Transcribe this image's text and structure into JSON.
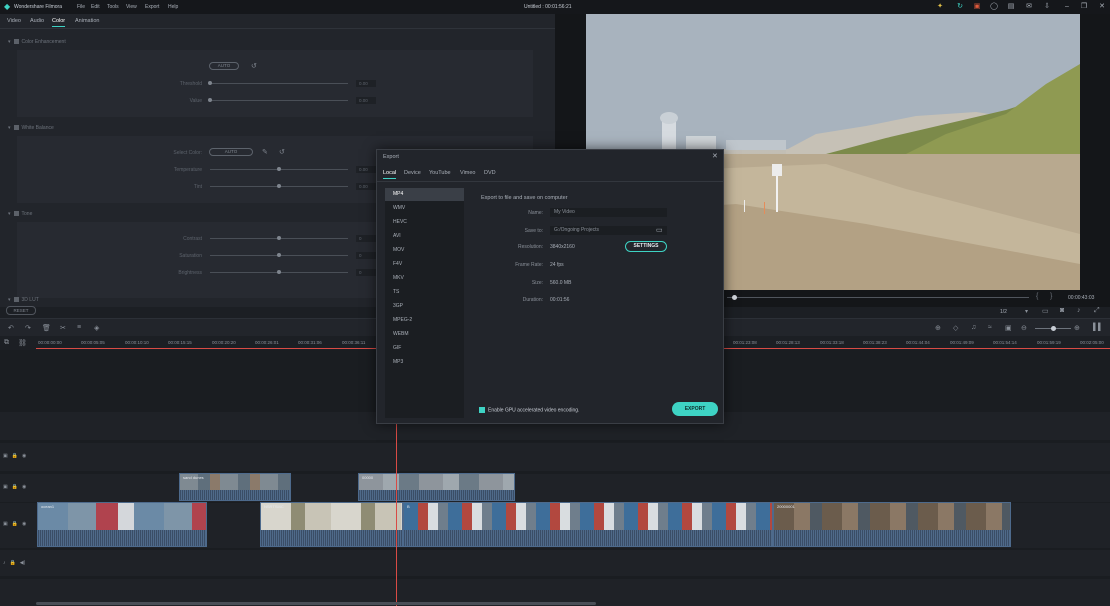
{
  "titlebar": {
    "app_name": "Wondershare Filmora",
    "menu": [
      "File",
      "Edit",
      "Tools",
      "View",
      "Export",
      "Help"
    ],
    "project_title": "Untitled : 00:01:56:21"
  },
  "editor_tabs": [
    "Video",
    "Audio",
    "Color",
    "Animation"
  ],
  "color_panel": {
    "sections": {
      "color_enhancement": "Color Enhancement",
      "white_balance": "White Balance",
      "tone": "Tone",
      "lut": "3D LUT"
    },
    "auto_label": "AUTO",
    "threshold_label": "Threshold",
    "value_label": "Value",
    "threshold_value": "0.00",
    "value_value": "0.00",
    "select_color_label": "Select Color:",
    "temperature_label": "Temperature",
    "tint_label": "Tint",
    "temperature_value": "0.00",
    "tint_value": "0.00",
    "contrast_label": "Contrast",
    "saturation_label": "Saturation",
    "brightness_label": "Brightness",
    "contrast_value": "0",
    "saturation_value": "0",
    "brightness_value": "0",
    "reset_label": "RESET"
  },
  "preview": {
    "timecode": "00:00:43:03",
    "quality": "1/2"
  },
  "timeline": {
    "ruler_ticks": [
      "00:00:00:00",
      "00:00:05:05",
      "00:00:10:10",
      "00:00:15:15",
      "00:00:20:20",
      "00:00:26:01",
      "00:00:31:06",
      "00:00:36:11",
      "00:01:23:08",
      "00:01:28:13",
      "00:01:33:18",
      "00:01:38:23",
      "00:01:44:04",
      "00:01:49:09",
      "00:01:54:14",
      "00:01:59:19",
      "00:02:05:00"
    ],
    "clip_labels": [
      "ocean1",
      "sand dunes",
      "00000",
      "NSRTSI4C",
      "B",
      "20000001"
    ]
  },
  "export_dialog": {
    "title": "Export",
    "tabs": [
      "Local",
      "Device",
      "YouTube",
      "Vimeo",
      "DVD"
    ],
    "formats": [
      "MP4",
      "WMV",
      "HEVC",
      "AVI",
      "MOV",
      "F4V",
      "MKV",
      "TS",
      "3GP",
      "MPEG-2",
      "WEBM",
      "GIF",
      "MP3"
    ],
    "selected_format": "MP4",
    "heading": "Export to file and save on computer",
    "name_label": "Name:",
    "name_value": "My Video",
    "save_to_label": "Save to:",
    "save_to_value": "G:/Ongoing Projects",
    "resolution_label": "Resolution:",
    "resolution_value": "3840x2160",
    "settings_label": "SETTINGS",
    "frame_rate_label": "Frame Rate:",
    "frame_rate_value": "24 fps",
    "size_label": "Size:",
    "size_value": "560.0 MB",
    "duration_label": "Duration:",
    "duration_value": "00:01:56",
    "gpu_label": "Enable GPU accelerated video encoding.",
    "export_label": "EXPORT"
  }
}
